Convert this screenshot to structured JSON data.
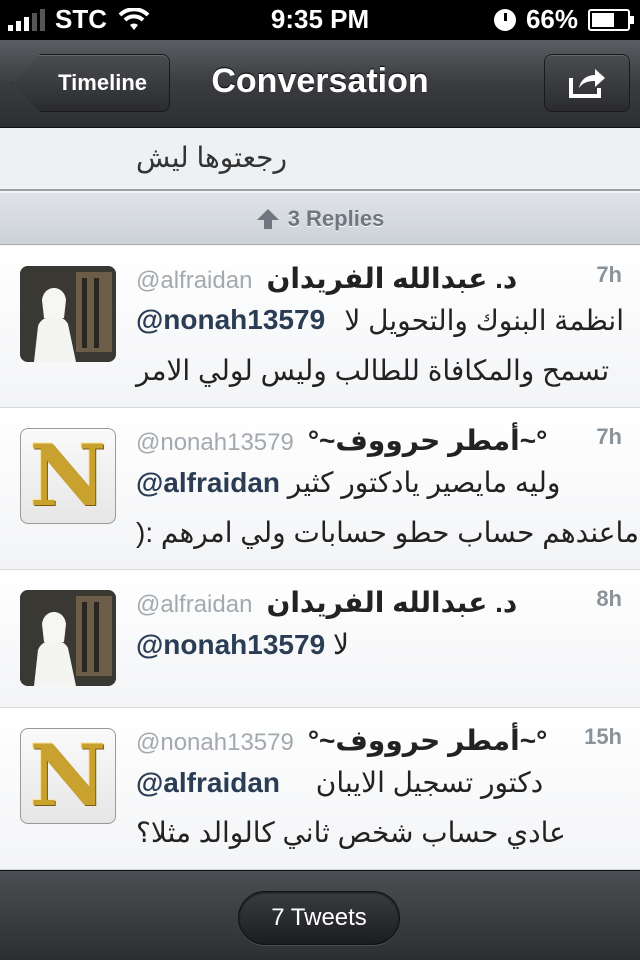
{
  "status_bar": {
    "carrier": "STC",
    "time": "9:35 PM",
    "battery": "66%",
    "battery_level": 0.66
  },
  "nav": {
    "back_label": "Timeline",
    "title": "Conversation",
    "share_icon": "share-icon"
  },
  "original_tweet": {
    "text": "رجعتوها ليش"
  },
  "replies_header": {
    "label": "3 Replies",
    "icon": "up-arrow-icon"
  },
  "tweets": [
    {
      "name": "د. عبدالله الفريدان",
      "handle": "@alfraidan",
      "time": "7h",
      "line1_mention": "",
      "line1_text": "انظمة البنوك والتحويل لا",
      "line2_mention": "@nonah13579",
      "line2_text": "",
      "line3_text": "تسمح والمكافاة للطالب وليس لولي الامر",
      "avatar": "photo"
    },
    {
      "name": "°~أمطر حرووف~°",
      "handle": "@nonah13579",
      "time": "7h",
      "line1_mention": "@alfraidan",
      "line1_text": "وليه مايصير يادكتور كثير",
      "line2_text": "ماعندهم حساب حطو حسابات ولي امرهم :(",
      "avatar": "N"
    },
    {
      "name": "د. عبدالله الفريدان",
      "handle": "@alfraidan",
      "time": "8h",
      "line1_mention": "@nonah13579",
      "line1_text": "لا",
      "avatar": "photo"
    },
    {
      "name": "°~أمطر حرووف~°",
      "handle": "@nonah13579",
      "time": "15h",
      "line1_mention": "@alfraidan",
      "line1_text": "دكتور تسجيل الايبان",
      "line2_text": "عادي حساب شخص ثاني كالوالد مثلا؟",
      "avatar": "N"
    }
  ],
  "bottom": {
    "count_label": "7 Tweets"
  }
}
